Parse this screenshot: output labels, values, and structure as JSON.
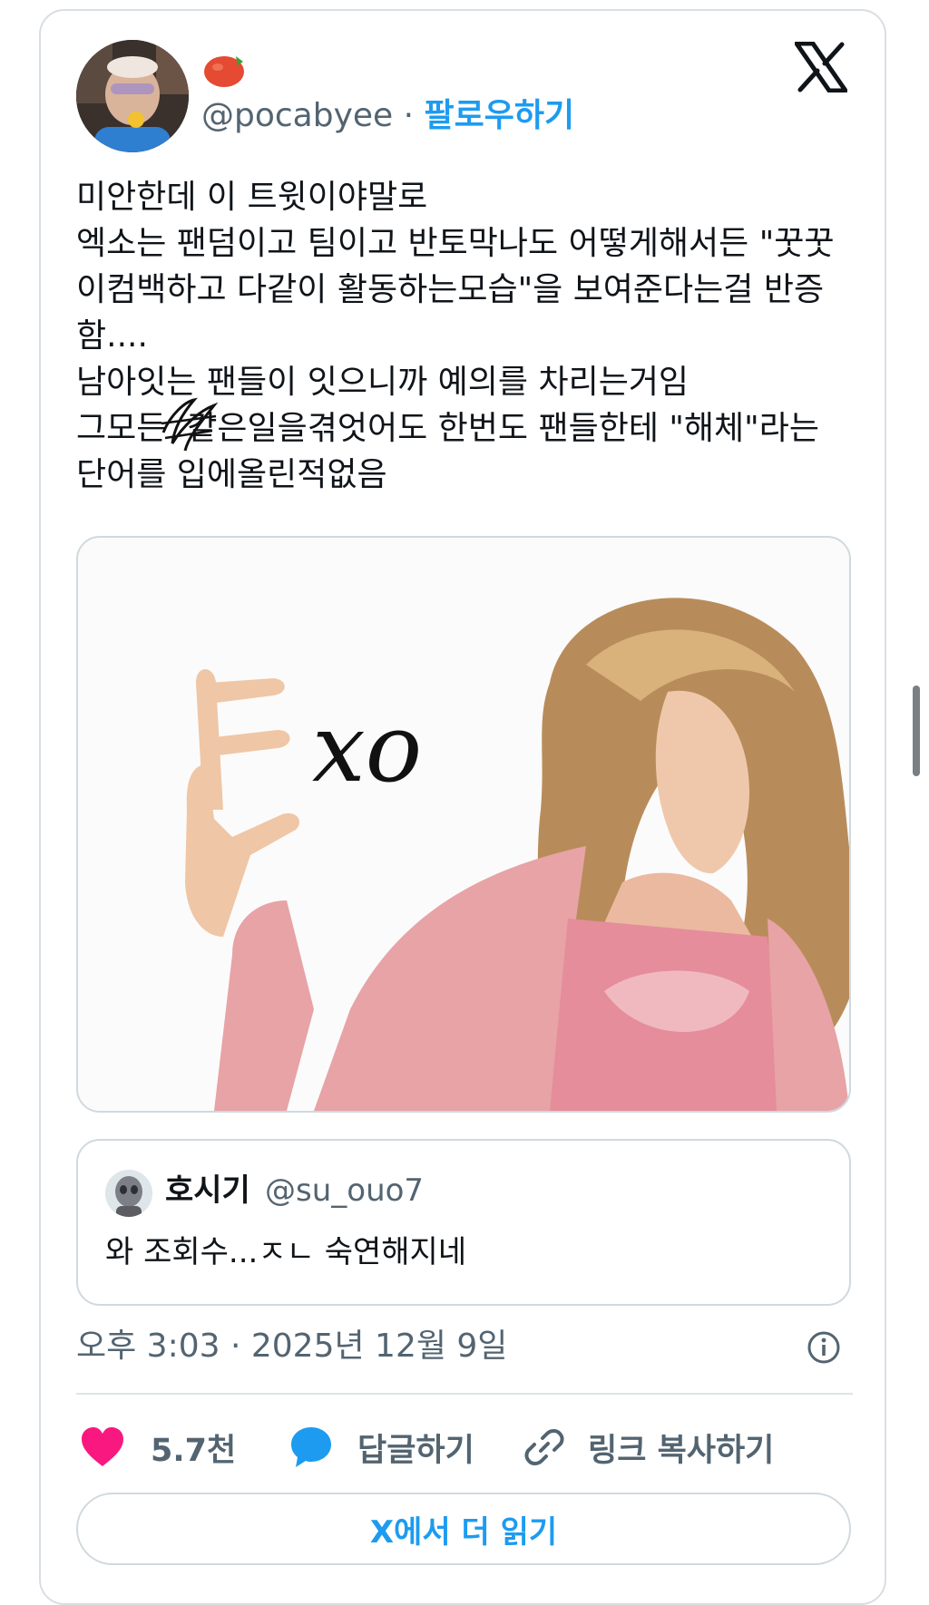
{
  "header": {
    "handle": "@pocabyee",
    "separator": "·",
    "follow_label": "팔로우하기",
    "emoji_icon": "tomato-emoji-icon",
    "logo_icon": "x-logo-icon"
  },
  "tweet": {
    "lines": [
      "미안한데 이 트윗이야말로",
      "엑소는 팬덤이고 팀이고 반토막나도 어떻게해서든 \"꿋꿋",
      "이컴백하고 다같이 활동하는모습\"을 보여준다는걸 반증",
      "함....",
      "남아잇는 팬들이 잇으니까 예의를 차리는거임",
      "그모든  같은일을겪엇어도 한번도 팬들한테 \"해체\"라는",
      "단어를 입에올린적없음"
    ]
  },
  "media": {
    "overlay_text": "xo"
  },
  "quote": {
    "name": "호시기",
    "handle": "@su_ouo7",
    "text": "와 조회수...ㅈㄴ 숙연해지네"
  },
  "timestamp": "오후 3:03 · 2025년 12월 9일",
  "actions": {
    "like_count": "5.7천",
    "reply_label": "답글하기",
    "copy_link_label": "링크 복사하기"
  },
  "read_more_label": "X에서 더 읽기",
  "colors": {
    "accent": "#1d9bf0",
    "like": "#f91880",
    "muted": "#536471"
  }
}
